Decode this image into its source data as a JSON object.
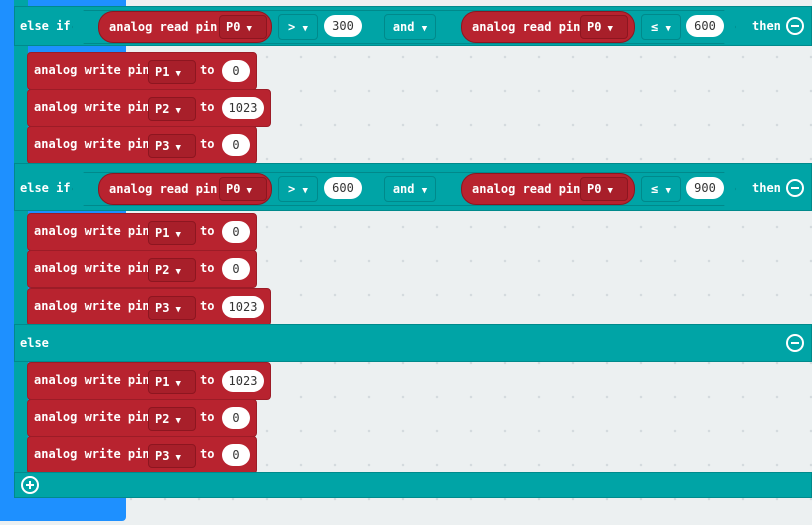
{
  "keywords": {
    "else_if": "else if",
    "else": "else",
    "then": "then",
    "and": "and",
    "to": "to"
  },
  "read_label": "analog read pin",
  "write_label": "analog write pin",
  "conditions": [
    {
      "left_pin": "P0",
      "op1": ">",
      "val1": "300",
      "right_pin": "P0",
      "op2": "≤",
      "val2": "600"
    },
    {
      "left_pin": "P0",
      "op1": ">",
      "val1": "600",
      "right_pin": "P0",
      "op2": "≤",
      "val2": "900"
    }
  ],
  "writes": [
    [
      {
        "pin": "P1",
        "value": "0"
      },
      {
        "pin": "P2",
        "value": "1023"
      },
      {
        "pin": "P3",
        "value": "0"
      }
    ],
    [
      {
        "pin": "P1",
        "value": "0"
      },
      {
        "pin": "P2",
        "value": "0"
      },
      {
        "pin": "P3",
        "value": "1023"
      }
    ],
    [
      {
        "pin": "P1",
        "value": "1023"
      },
      {
        "pin": "P2",
        "value": "0"
      },
      {
        "pin": "P3",
        "value": "0"
      }
    ]
  ],
  "colors": {
    "logic": "#00a4a6",
    "pins": "#b8232f",
    "stack": "#1e90ff",
    "workspace": "#ecf0f1"
  },
  "icons": {
    "remove": "minus-circle-icon",
    "add": "plus-circle-icon",
    "dropdown": "triangle-down-icon"
  }
}
